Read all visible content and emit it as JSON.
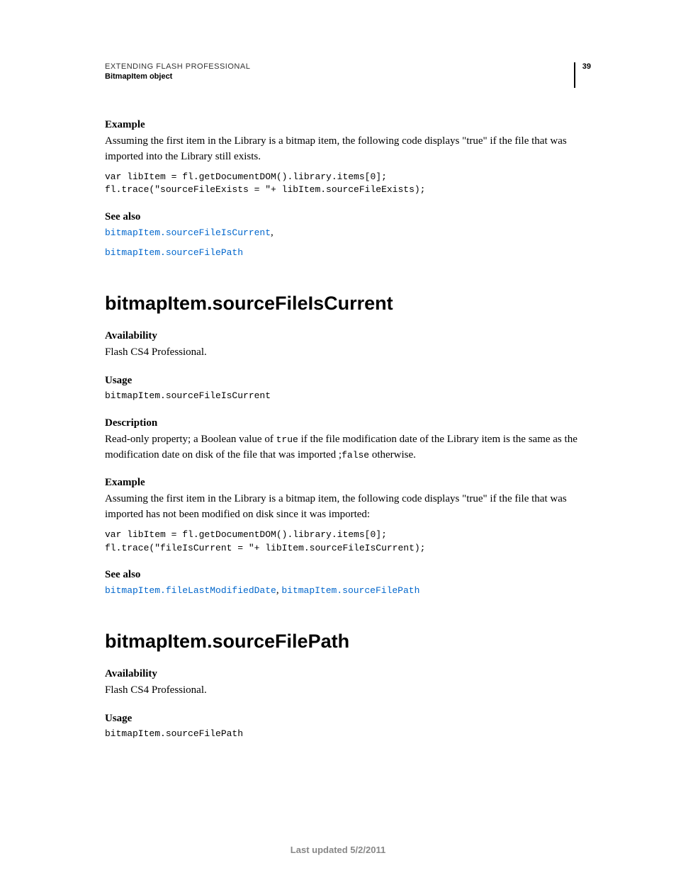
{
  "header": {
    "doc_title": "EXTENDING FLASH PROFESSIONAL",
    "chapter": "BitmapItem object",
    "page_number": "39"
  },
  "section1": {
    "example_h": "Example",
    "example_text": "Assuming the first item in the Library is a bitmap item, the following code displays \"true\" if the file that was imported into the Library still exists.",
    "example_code": "var libItem = fl.getDocumentDOM().library.items[0];\nfl.trace(\"sourceFileExists = \"+ libItem.sourceFileExists);",
    "see_also_h": "See also",
    "see_also_links": [
      "bitmapItem.sourceFileIsCurrent",
      "bitmapItem.sourceFilePath"
    ]
  },
  "section2": {
    "title": "bitmapItem.sourceFileIsCurrent",
    "availability_h": "Availability",
    "availability_text": "Flash CS4 Professional.",
    "usage_h": "Usage",
    "usage_code": "bitmapItem.sourceFileIsCurrent",
    "description_h": "Description",
    "description_pre": "Read-only property; a Boolean value of ",
    "description_true": "true",
    "description_mid": " if the file modification date of the Library item is the same as the modification date on disk of the file that was imported ;",
    "description_false": "false",
    "description_post": " otherwise.",
    "example_h": "Example",
    "example_text": "Assuming the first item in the Library is a bitmap item, the following code displays \"true\" if the file that was imported has not been modified on disk since it was imported:",
    "example_code": "var libItem = fl.getDocumentDOM().library.items[0];\nfl.trace(\"fileIsCurrent = \"+ libItem.sourceFileIsCurrent);",
    "see_also_h": "See also",
    "see_also_link1": "bitmapItem.fileLastModifiedDate",
    "see_also_link2": "bitmapItem.sourceFilePath"
  },
  "section3": {
    "title": "bitmapItem.sourceFilePath",
    "availability_h": "Availability",
    "availability_text": "Flash CS4 Professional.",
    "usage_h": "Usage",
    "usage_code": "bitmapItem.sourceFilePath"
  },
  "footer": {
    "last_updated": "Last updated 5/2/2011"
  }
}
